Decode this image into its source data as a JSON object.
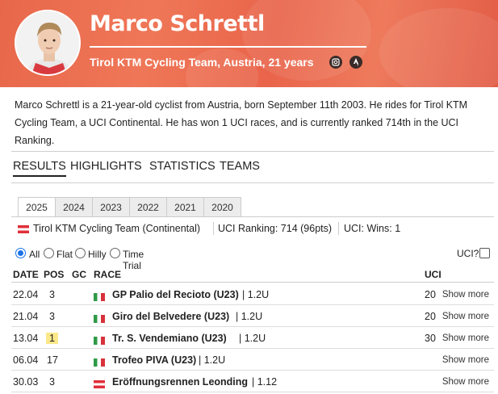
{
  "rider": {
    "name": "Marco Schrettl",
    "subtitle": "Tirol KTM Cycling Team, Austria, 21 years",
    "icons": [
      "instagram-icon",
      "strava-icon"
    ]
  },
  "bio": "Marco Schrettl is a 21-year-old cyclist from Austria, born September 11th 2003. He rides for Tirol KTM Cycling Team, a UCI Continental. He has won 1 UCI races, and is currently ranked 714th in the UCI Ranking.",
  "nav": [
    "RESULTS",
    "HIGHLIGHTS",
    "STATISTICS",
    "TEAMS"
  ],
  "years": [
    "2025",
    "2024",
    "2023",
    "2022",
    "2021",
    "2020"
  ],
  "team_bar": {
    "team": "Tirol KTM Cycling Team (Continental)",
    "ranking": "UCI Ranking: 714 (96pts)",
    "wins": "UCI: Wins: 1"
  },
  "filters": {
    "options": [
      "All",
      "Flat",
      "Hilly",
      "Time Trial"
    ],
    "selected": "All",
    "uci_toggle": "UCI?"
  },
  "table": {
    "headers": [
      "DATE",
      "POS",
      "GC",
      "RACE",
      "UCI"
    ],
    "more_label": "Show more",
    "rows": [
      {
        "date": "22.04",
        "pos": "3",
        "gc": "",
        "flag": "it",
        "race": "GP Palio del Recioto (U23)",
        "cls": "| 1.2U",
        "uci": "20",
        "highlight": false
      },
      {
        "date": "21.04",
        "pos": "3",
        "gc": "",
        "flag": "it",
        "race": "Giro del Belvedere (U23)",
        "cls": "| 1.2U",
        "uci": "20",
        "highlight": false
      },
      {
        "date": "13.04",
        "pos": "1",
        "gc": "",
        "flag": "it",
        "race": "Tr. S. Vendemiano (U23)",
        "cls": "| 1.2U",
        "uci": "30",
        "highlight": true
      },
      {
        "date": "06.04",
        "pos": "17",
        "gc": "",
        "flag": "it",
        "race": "Trofeo PIVA (U23)",
        "cls": "| 1.2U",
        "uci": "",
        "highlight": false
      },
      {
        "date": "30.03",
        "pos": "3",
        "gc": "",
        "flag": "at",
        "race": "Eröffnungsrennen Leonding",
        "cls": "| 1.12",
        "uci": "",
        "highlight": false
      }
    ]
  },
  "colors": {
    "header_bg": "#ea6a4d",
    "highlight": "#fbe88a",
    "radio_accent": "#1a73e8"
  }
}
